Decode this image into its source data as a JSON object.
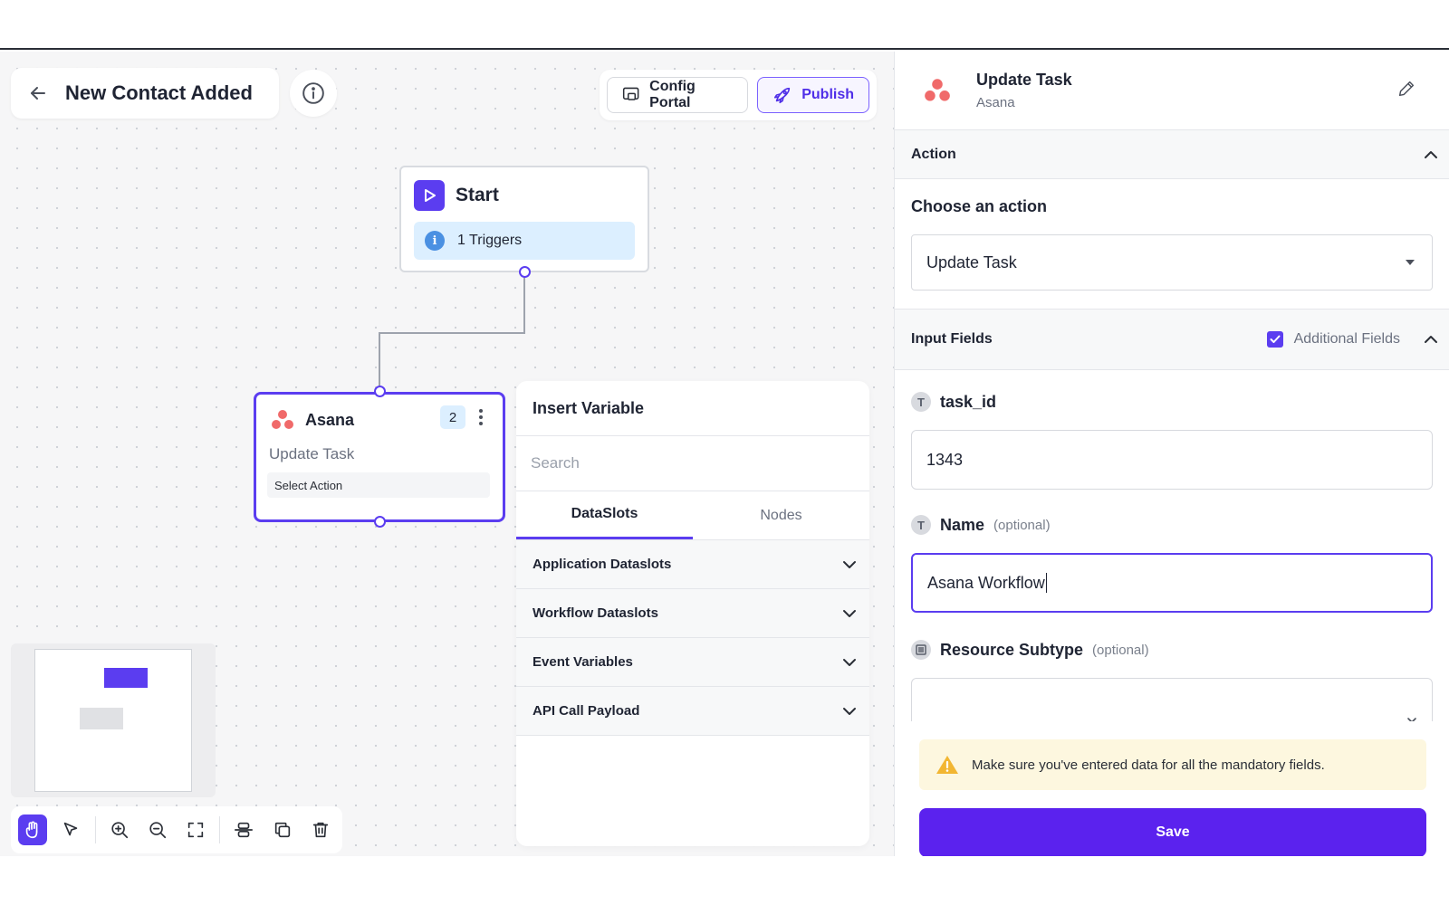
{
  "workflow": {
    "title": "New Contact Added"
  },
  "header_actions": {
    "config_portal_label": "Config Portal",
    "publish_label": "Publish"
  },
  "start_node": {
    "title": "Start",
    "triggers_label": "1 Triggers"
  },
  "asana_node": {
    "app_name": "Asana",
    "badge_count": "2",
    "action_name": "Update Task",
    "select_action_label": "Select Action"
  },
  "insert_variable": {
    "title": "Insert Variable",
    "search_placeholder": "Search",
    "tabs": [
      {
        "label": "DataSlots",
        "active": true
      },
      {
        "label": "Nodes",
        "active": false
      }
    ],
    "sections": [
      {
        "label": "Application Dataslots"
      },
      {
        "label": "Workflow Dataslots"
      },
      {
        "label": "Event Variables"
      },
      {
        "label": "API Call Payload"
      }
    ]
  },
  "right_panel": {
    "title": "Update Task",
    "subtitle": "Asana",
    "action_section": "Action",
    "choose_label": "Choose an action",
    "selected_action": "Update Task",
    "input_fields_section": "Input Fields",
    "additional_fields_label": "Additional Fields",
    "additional_fields_checked": true,
    "fields": [
      {
        "name": "task_id",
        "optional_label": "",
        "type_icon": "text-type-icon",
        "value": "1343"
      },
      {
        "name": "Name",
        "optional_label": "(optional)",
        "type_icon": "text-type-icon",
        "value": "Asana Workflow"
      },
      {
        "name": "Resource Subtype",
        "optional_label": "(optional)",
        "type_icon": "list-type-icon",
        "value": ""
      }
    ],
    "warning": "Make sure you've entered data for all the mandatory fields.",
    "save_label": "Save"
  },
  "toolbar": {
    "tools": [
      "hand-icon",
      "pointer-icon",
      "zoom-in-icon",
      "zoom-out-icon",
      "fit-view-icon",
      "align-icon",
      "copy-icon",
      "trash-icon"
    ],
    "active_tool": "hand-icon"
  },
  "colors": {
    "accent": "#5b3df0",
    "save": "#5b22ee",
    "trigger_bg": "#dcefff",
    "warning_bg": "#fdf7df",
    "asana_red": "#f06a6a"
  }
}
